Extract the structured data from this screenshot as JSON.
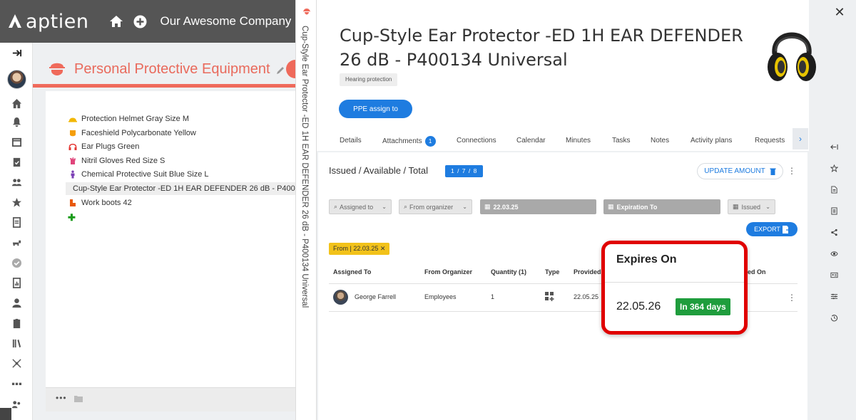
{
  "app": {
    "logo_text": "aptien",
    "company": "Our Awesome Company"
  },
  "left_panel": {
    "title": "Personal Protective Equipment",
    "items": [
      {
        "label": "Protection Helmet Gray Size M",
        "icon": "helmet-icon",
        "color": "#f2b705"
      },
      {
        "label": "Faceshield Polycarbonate Yellow",
        "icon": "faceshield-icon",
        "color": "#f59e0b"
      },
      {
        "label": "Ear Plugs Green",
        "icon": "headphones-icon",
        "color": "#e53935"
      },
      {
        "label": "Nitril Gloves Red Size S",
        "icon": "gloves-icon",
        "color": "#e0457b"
      },
      {
        "label": "Chemical Protective Suit Blue Size L",
        "icon": "suit-icon",
        "color": "#7b3fb5"
      },
      {
        "label": "Cup-Style Ear Protector -ED 1H EAR DEFENDER 26 dB - P400134 Universal",
        "icon": "headphones-icon",
        "color": "#e53935",
        "selected": true
      },
      {
        "label": "Work boots 42",
        "icon": "boots-icon",
        "color": "#e8590c"
      }
    ]
  },
  "vertical_title": "Cup-Style Ear Protector -ED 1H EAR DEFENDER 26 dB - P400134 Universal",
  "detail": {
    "title": "Cup-Style Ear Protector -ED 1H EAR DEFENDER 26 dB - P400134 Universal",
    "tag": "Hearing protection",
    "assign_button": "PPE assign to",
    "tabs": [
      {
        "label": "Details"
      },
      {
        "label": "Attachments",
        "badge": "1"
      },
      {
        "label": "Connections"
      },
      {
        "label": "Calendar"
      },
      {
        "label": "Minutes"
      },
      {
        "label": "Tasks"
      },
      {
        "label": "Notes"
      },
      {
        "label": "Activity plans"
      },
      {
        "label": "Requests"
      }
    ],
    "section_title": "Issued / Available / Total",
    "counts": "1 / 7 / 8",
    "update_button": "UPDATE AMOUNT",
    "filters": {
      "assigned_to": "Assigned to",
      "from_organizer": "From organizer",
      "date_from": "22.03.25",
      "expiration_to": "Expiration To",
      "status": "Issued"
    },
    "export_button": "EXPORT",
    "active_chip": "From | 22.03.25 ✕",
    "table": {
      "headers": [
        "Assigned To",
        "From Organizer",
        "Quantity (1)",
        "Type",
        "Provided",
        "ed On"
      ],
      "rows": [
        {
          "assigned_to": "George Farrell",
          "from_organizer": "Employees",
          "quantity": "1",
          "provided": "22.05.25"
        }
      ]
    },
    "callout": {
      "title": "Expires On",
      "date": "22.05.26",
      "badge": "In 364 days"
    }
  },
  "colors": {
    "accent_blue": "#1e7ce0",
    "brand_red": "#ef6a5b",
    "success_green": "#1f9d3d",
    "highlight_red": "#e00000",
    "chip_yellow": "#f2c21a"
  }
}
